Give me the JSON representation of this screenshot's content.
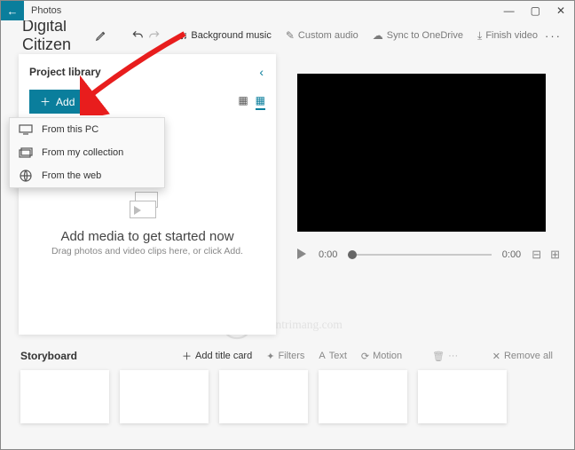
{
  "window": {
    "app_title": "Photos",
    "minimize": "—",
    "maximize": "▢",
    "close": "✕"
  },
  "project": {
    "name": "Digital Citizen"
  },
  "toolbar": {
    "background_music": "Background music",
    "custom_audio": "Custom audio",
    "sync_onedrive": "Sync to OneDrive",
    "finish_video": "Finish video"
  },
  "library": {
    "title": "Project library",
    "add_label": "Add",
    "empty_title": "Add media to get started now",
    "empty_sub": "Drag photos and video clips here, or click Add."
  },
  "add_menu": {
    "items": [
      {
        "label": "From this PC"
      },
      {
        "label": "From my collection"
      },
      {
        "label": "From the web"
      }
    ]
  },
  "player": {
    "current_time": "0:00",
    "total_time": "0:00"
  },
  "storyboard": {
    "title": "Storyboard",
    "add_title_card": "Add title card",
    "filters": "Filters",
    "text": "Text",
    "motion": "Motion",
    "remove_all": "Remove all"
  },
  "watermark": "Quantrimang.com"
}
